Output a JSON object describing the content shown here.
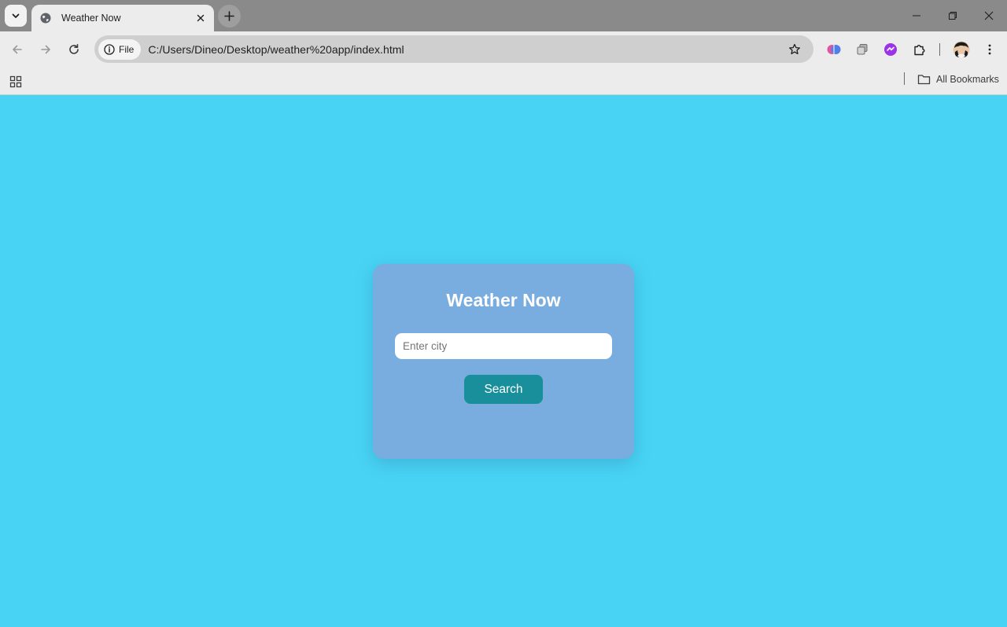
{
  "browser": {
    "tab": {
      "title": "Weather Now"
    },
    "address_bar": {
      "site_chip_label": "File",
      "url": "C:/Users/Dineo/Desktop/weather%20app/index.html"
    },
    "bookmarks_bar": {
      "all_bookmarks_label": "All Bookmarks"
    },
    "colors": {
      "tab_strip": "#8a8a8a",
      "toolbar": "#ececec"
    }
  },
  "page": {
    "title": "Weather Now",
    "search": {
      "placeholder": "Enter city",
      "value": "",
      "button_label": "Search"
    },
    "colors": {
      "background": "#48d3f4",
      "card": "#79addf",
      "button": "#188f9b",
      "title_text": "#ffffff"
    }
  },
  "icons": {
    "tab_search": "chevron-down-icon",
    "favicon": "globe-icon",
    "tab_close": "close-icon",
    "new_tab": "plus-icon",
    "back": "back-arrow-icon",
    "forward": "forward-arrow-icon",
    "reload": "reload-icon",
    "site_info": "info-icon",
    "bookmark": "star-icon",
    "extensions": "puzzle-icon",
    "profile": "avatar",
    "menu": "kebab-menu-icon",
    "apps": "apps-grid-icon",
    "folder": "folder-icon"
  }
}
